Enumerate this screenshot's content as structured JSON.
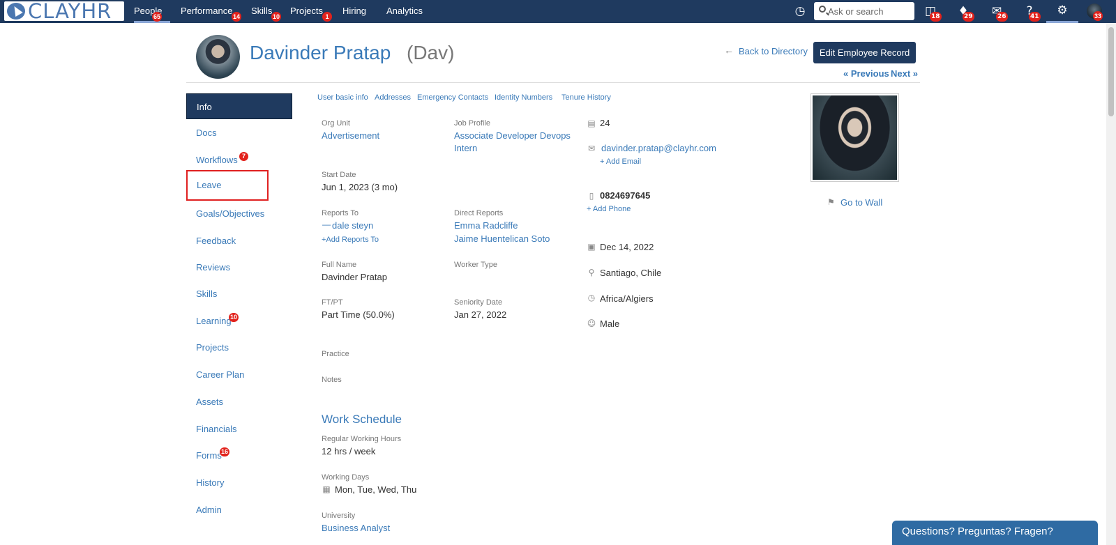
{
  "nav": {
    "logo_text": "CLAY",
    "logo_text2": "HR",
    "items": [
      {
        "label": "People",
        "badge": "65"
      },
      {
        "label": "Performance",
        "badge": "14"
      },
      {
        "label": "Skills",
        "badge": "10"
      },
      {
        "label": "Projects",
        "badge": "1"
      },
      {
        "label": "Hiring",
        "badge": ""
      },
      {
        "label": "Analytics",
        "badge": ""
      }
    ],
    "search_placeholder": "Ask or search",
    "icon_badges": {
      "courses": "18",
      "notifications": "29",
      "messages": "26",
      "help": "41",
      "profile": "33"
    }
  },
  "header": {
    "name": "Davinder Pratap",
    "nickname": "(Dav)",
    "back_link": "Back to Directory",
    "edit_button": "Edit Employee Record",
    "previous": "« Previous",
    "next": "Next »"
  },
  "sidebar": {
    "items": [
      {
        "label": "Info",
        "badge": ""
      },
      {
        "label": "Docs",
        "badge": ""
      },
      {
        "label": "Workflows",
        "badge": "7"
      },
      {
        "label": "Leave",
        "badge": ""
      },
      {
        "label": "Goals/Objectives",
        "badge": ""
      },
      {
        "label": "Feedback",
        "badge": ""
      },
      {
        "label": "Reviews",
        "badge": ""
      },
      {
        "label": "Skills",
        "badge": ""
      },
      {
        "label": "Learning",
        "badge": "10"
      },
      {
        "label": "Projects",
        "badge": ""
      },
      {
        "label": "Career Plan",
        "badge": ""
      },
      {
        "label": "Assets",
        "badge": ""
      },
      {
        "label": "Financials",
        "badge": ""
      },
      {
        "label": "Forms",
        "badge": "16"
      },
      {
        "label": "History",
        "badge": ""
      },
      {
        "label": "Admin",
        "badge": ""
      }
    ]
  },
  "subtabs": [
    "User basic info",
    "Addresses",
    "Emergency Contacts",
    "Identity Numbers",
    "Tenure History"
  ],
  "fields": {
    "org_unit": {
      "label": "Org Unit",
      "value": "Advertisement"
    },
    "job_profile": {
      "label": "Job Profile",
      "value_line1": "Associate Developer Devops",
      "value_line2": "Intern"
    },
    "start_date": {
      "label": "Start Date",
      "value": "Jun 1, 2023 (3 mo)"
    },
    "reports_to": {
      "label": "Reports To",
      "value": "dale steyn",
      "add": "+Add Reports To"
    },
    "direct_reports": {
      "label": "Direct Reports",
      "values": [
        "Emma Radcliffe",
        "Jaime Huentelican Soto"
      ]
    },
    "full_name": {
      "label": "Full Name",
      "value": "Davinder Pratap"
    },
    "worker_type": {
      "label": "Worker Type",
      "value": ""
    },
    "ftpt": {
      "label": "FT/PT",
      "value": "Part Time (50.0%)"
    },
    "seniority_date": {
      "label": "Seniority Date",
      "value": "Jan 27, 2022"
    },
    "practice": {
      "label": "Practice"
    },
    "notes": {
      "label": "Notes"
    }
  },
  "contact": {
    "id": "24",
    "email": "davinder.pratap@clayhr.com",
    "add_email": "+ Add Email",
    "phone": "0824697645",
    "add_phone": "+ Add Phone",
    "birthday": "Dec 14, 2022",
    "location": "Santiago, Chile",
    "timezone": "Africa/Algiers",
    "gender": "Male"
  },
  "work_schedule": {
    "title": "Work Schedule",
    "hours_label": "Regular Working Hours",
    "hours_value": "12 hrs / week",
    "days_label": "Working Days",
    "days_value": "Mon, Tue, Wed, Thu",
    "university_label": "University",
    "university_value": "Business Analyst"
  },
  "right": {
    "go_to_wall": "Go to Wall"
  },
  "chat": {
    "label": "Questions? Preguntas? Fragen?"
  }
}
